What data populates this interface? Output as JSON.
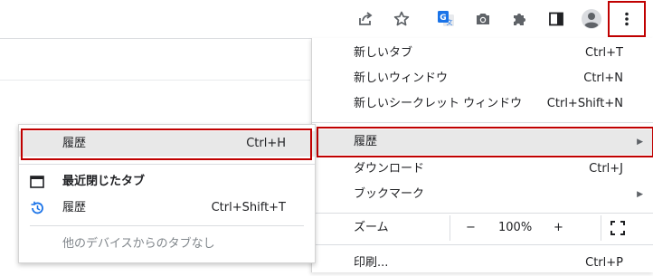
{
  "toolbar": {
    "icons": [
      "share-icon",
      "bookmark-star-icon",
      "google-translate-icon",
      "camera-icon",
      "extensions-puzzle-icon",
      "side-panel-icon",
      "profile-avatar-icon",
      "kebab-menu-icon"
    ]
  },
  "main_menu": {
    "new_tab": {
      "label": "新しいタブ",
      "shortcut": "Ctrl+T"
    },
    "new_window": {
      "label": "新しいウィンドウ",
      "shortcut": "Ctrl+N"
    },
    "new_incognito": {
      "label": "新しいシークレット ウィンドウ",
      "shortcut": "Ctrl+Shift+N"
    },
    "history": {
      "label": "履歴"
    },
    "downloads": {
      "label": "ダウンロード",
      "shortcut": "Ctrl+J"
    },
    "bookmarks": {
      "label": "ブックマーク"
    },
    "zoom": {
      "label": "ズーム",
      "minus": "−",
      "value": "100%",
      "plus": "+"
    },
    "print": {
      "label": "印刷...",
      "shortcut": "Ctrl+P"
    }
  },
  "history_submenu": {
    "history": {
      "label": "履歴",
      "shortcut": "Ctrl+H"
    },
    "recently_closed": {
      "label": "最近閉じたタブ"
    },
    "restore_history": {
      "label": "履歴",
      "shortcut": "Ctrl+Shift+T"
    },
    "no_other_devices": {
      "label": "他のデバイスからのタブなし"
    }
  },
  "colors": {
    "highlight_border": "#c00000",
    "highlight_bg": "#e8e8e8",
    "translate_blue": "#1a73e8",
    "icon_gray": "#5f6368"
  }
}
